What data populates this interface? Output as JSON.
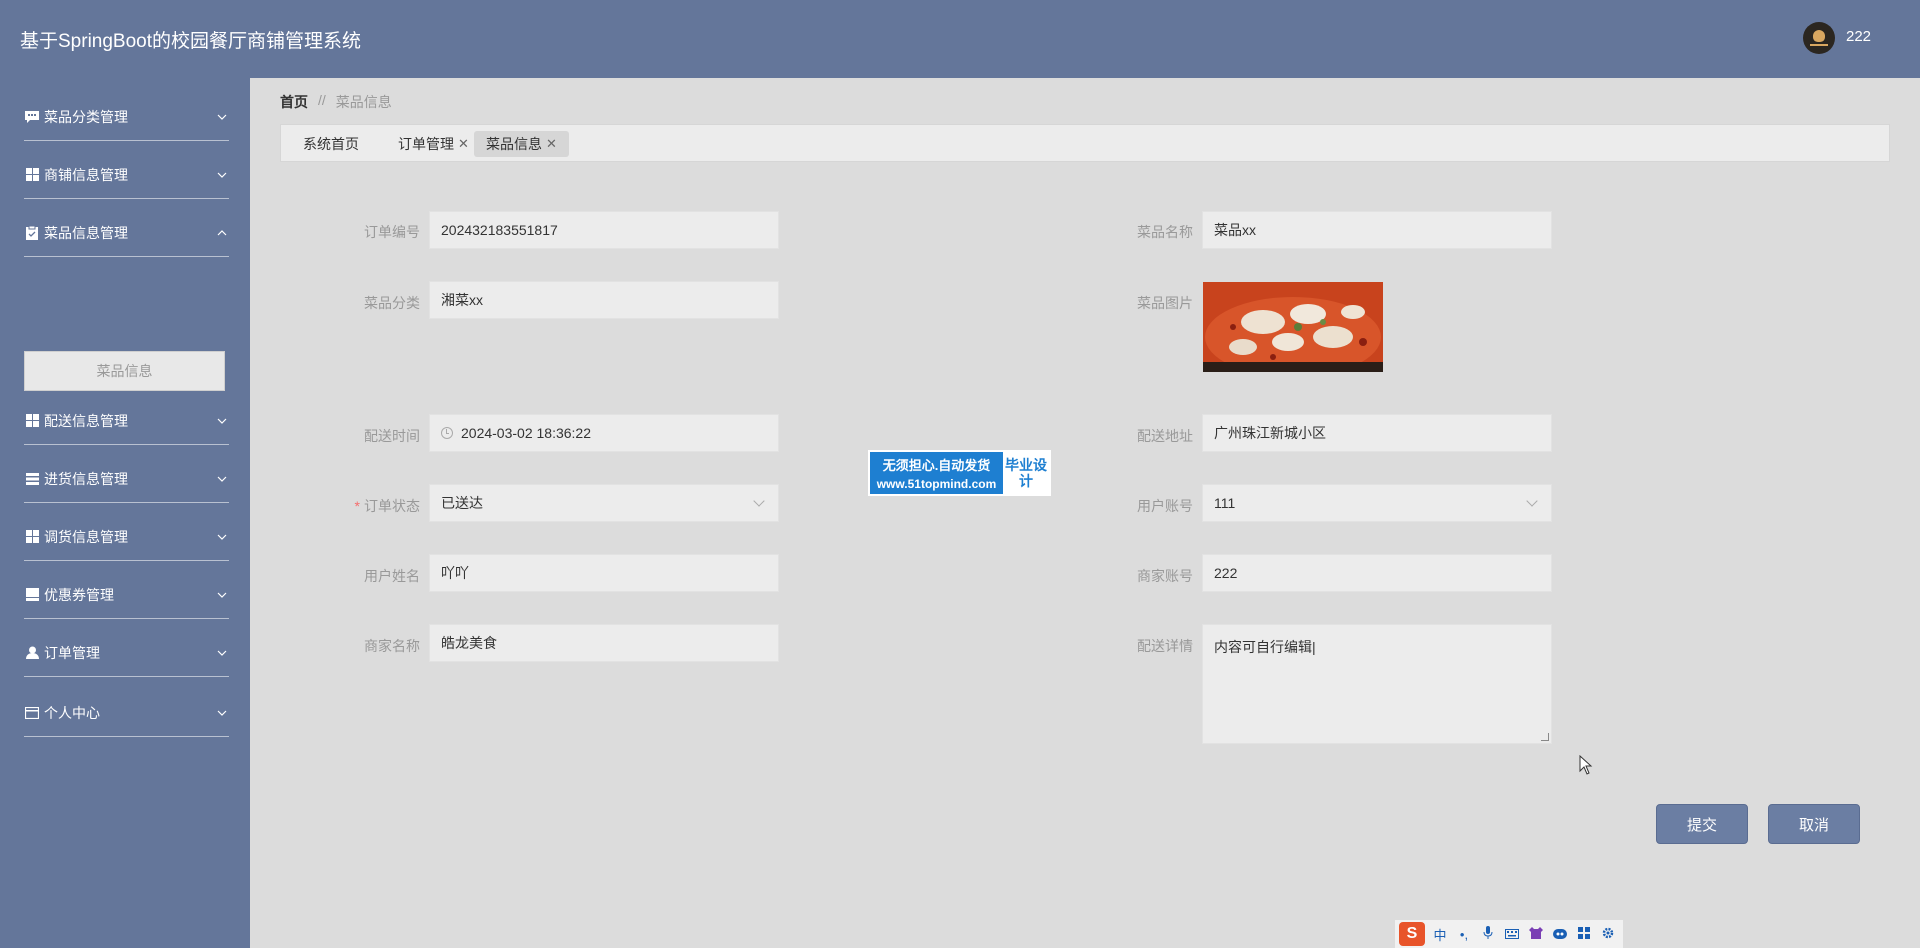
{
  "header": {
    "title": "基于SpringBoot的校园餐厅商铺管理系统",
    "username": "222"
  },
  "sidebar": {
    "items": [
      {
        "label": "菜品分类管理",
        "icon": "message-icon",
        "expanded": false
      },
      {
        "label": "商铺信息管理",
        "icon": "grid-icon",
        "expanded": false
      },
      {
        "label": "菜品信息管理",
        "icon": "clipboard-icon",
        "expanded": true
      },
      {
        "label": "配送信息管理",
        "icon": "grid-icon",
        "expanded": false
      },
      {
        "label": "进货信息管理",
        "icon": "list-icon",
        "expanded": false
      },
      {
        "label": "调货信息管理",
        "icon": "grid-icon",
        "expanded": false
      },
      {
        "label": "优惠券管理",
        "icon": "ticket-icon",
        "expanded": false
      },
      {
        "label": "订单管理",
        "icon": "user-icon",
        "expanded": false
      },
      {
        "label": "个人中心",
        "icon": "card-icon",
        "expanded": false
      }
    ],
    "sub_item": "菜品信息"
  },
  "breadcrumb": {
    "home": "首页",
    "separator": "//",
    "current": "菜品信息"
  },
  "tabs": [
    {
      "label": "系统首页",
      "closable": false
    },
    {
      "label": "订单管理",
      "closable": true
    },
    {
      "label": "菜品信息",
      "closable": true,
      "active": true
    }
  ],
  "form": {
    "order_no": {
      "label": "订单编号",
      "value": "202432183551817"
    },
    "dish_name": {
      "label": "菜品名称",
      "value": "菜品xx"
    },
    "dish_category": {
      "label": "菜品分类",
      "value": "湘菜xx"
    },
    "dish_image": {
      "label": "菜品图片"
    },
    "delivery_time": {
      "label": "配送时间",
      "value": "2024-03-02 18:36:22"
    },
    "delivery_address": {
      "label": "配送地址",
      "value": "广州珠江新城小区"
    },
    "order_status": {
      "label": "订单状态",
      "value": "已送达",
      "required": true
    },
    "user_account": {
      "label": "用户账号",
      "value": "111"
    },
    "user_name": {
      "label": "用户姓名",
      "value": "吖吖"
    },
    "merchant_account": {
      "label": "商家账号",
      "value": "222"
    },
    "merchant_name": {
      "label": "商家名称",
      "value": "皓龙美食"
    },
    "delivery_detail": {
      "label": "配送详情",
      "value": "内容可自行编辑|"
    }
  },
  "watermark": {
    "line1": "无须担心.自动发货",
    "line2": "www.51topmind.com",
    "badge": "毕业设计"
  },
  "buttons": {
    "submit": "提交",
    "cancel": "取消"
  },
  "ime": {
    "logo": "S",
    "mode": "中",
    "punct": "•,"
  },
  "colors": {
    "primary": "#64769a",
    "button": "#6b7ea3",
    "background": "#dcdcdc",
    "required": "#f56c6c"
  }
}
